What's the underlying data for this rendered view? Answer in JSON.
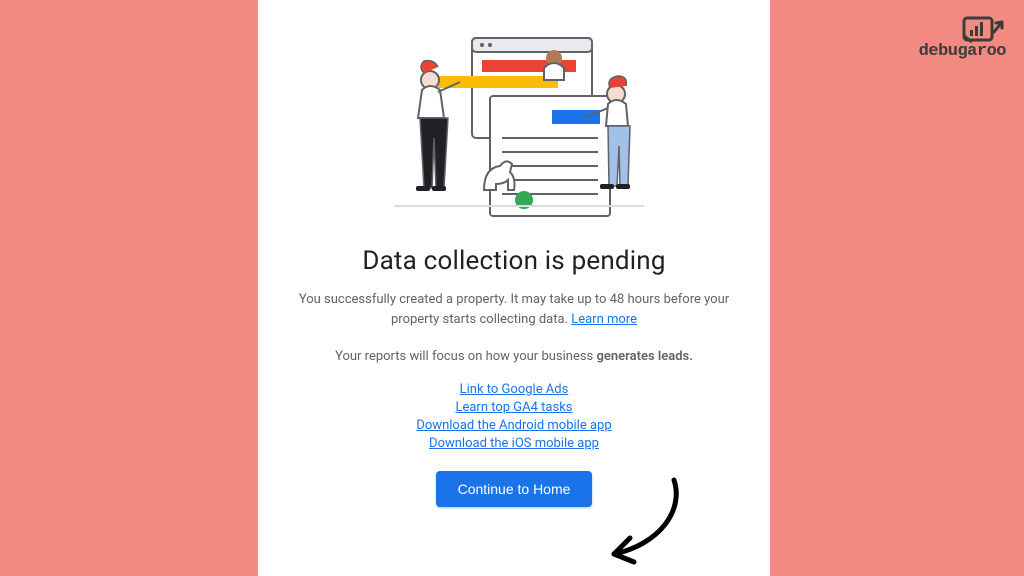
{
  "brand": {
    "label": "debugaroo"
  },
  "heading": "Data collection is pending",
  "paragraph": {
    "before": "You successfully created a property. It may take up to 48 hours before your property starts collecting data. ",
    "learn_more": "Learn more"
  },
  "subline": {
    "before": "Your reports will focus on how your business ",
    "bold": "generates leads."
  },
  "links": [
    "Link to Google Ads",
    "Learn top GA4 tasks",
    "Download the Android mobile app",
    "Download the iOS mobile app"
  ],
  "cta_label": "Continue to Home"
}
